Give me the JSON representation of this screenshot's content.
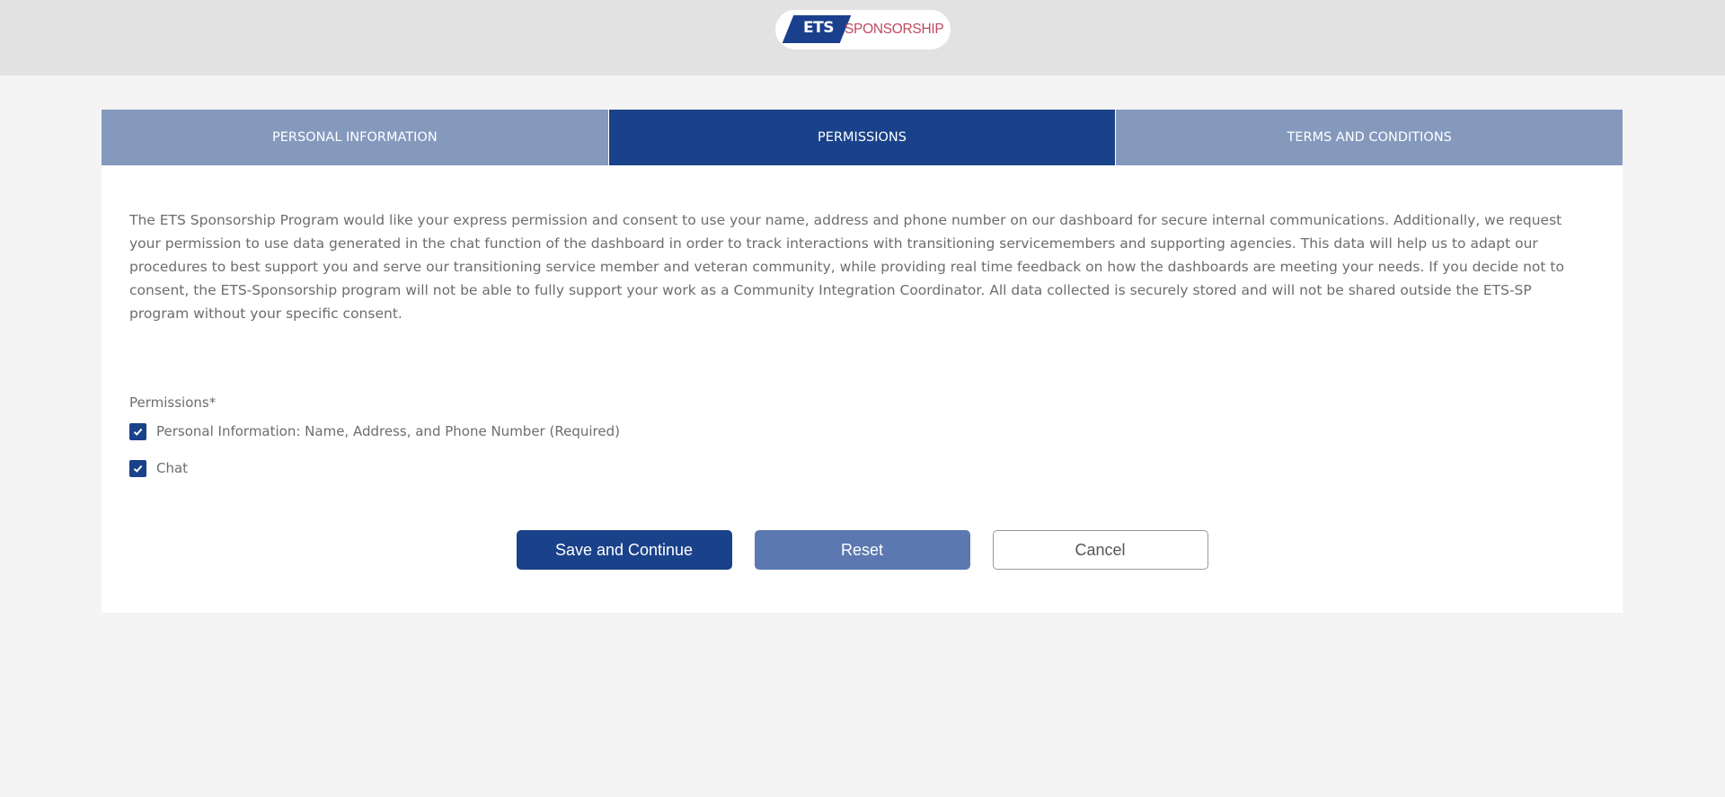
{
  "header": {
    "logo": {
      "mark_text": "ETS",
      "word_text": "SPONSORSHIP",
      "mark_color": "#1a3f8c",
      "word_color": "#c0485d"
    }
  },
  "tabs": [
    {
      "label": "PERSONAL INFORMATION",
      "active": false
    },
    {
      "label": "PERMISSIONS",
      "active": true
    },
    {
      "label": "TERMS AND CONDITIONS",
      "active": false
    }
  ],
  "intro_text": "The ETS Sponsorship Program would like your express permission and consent to use your name, address and phone number on our dashboard for secure internal communications. Additionally, we request your permission to use data generated in the chat function of the dashboard in order to track interactions with transitioning servicemembers and supporting agencies. This data will help us to adapt our procedures to best support you and serve our transitioning service member and veteran community, while providing real time feedback on how the dashboards are meeting your needs. If you decide not to consent, the ETS-Sponsorship program will not be able to fully support your work as a Community Integration Coordinator. All data collected is securely stored and will not be shared outside the ETS-SP program without your specific consent.",
  "permissions": {
    "label": "Permissions*",
    "options": [
      {
        "label": "Personal Information: Name, Address, and Phone Number (Required)",
        "checked": true
      },
      {
        "label": "Chat",
        "checked": true
      }
    ]
  },
  "actions": {
    "save_label": "Save and Continue",
    "reset_label": "Reset",
    "cancel_label": "Cancel"
  },
  "colors": {
    "primary": "#1a428a",
    "tab_inactive": "#8599bd",
    "reset_button": "#5b79b0",
    "page_background": "#f4f4f4",
    "header_background": "#e2e2e2",
    "body_text": "#6d6d6d"
  }
}
